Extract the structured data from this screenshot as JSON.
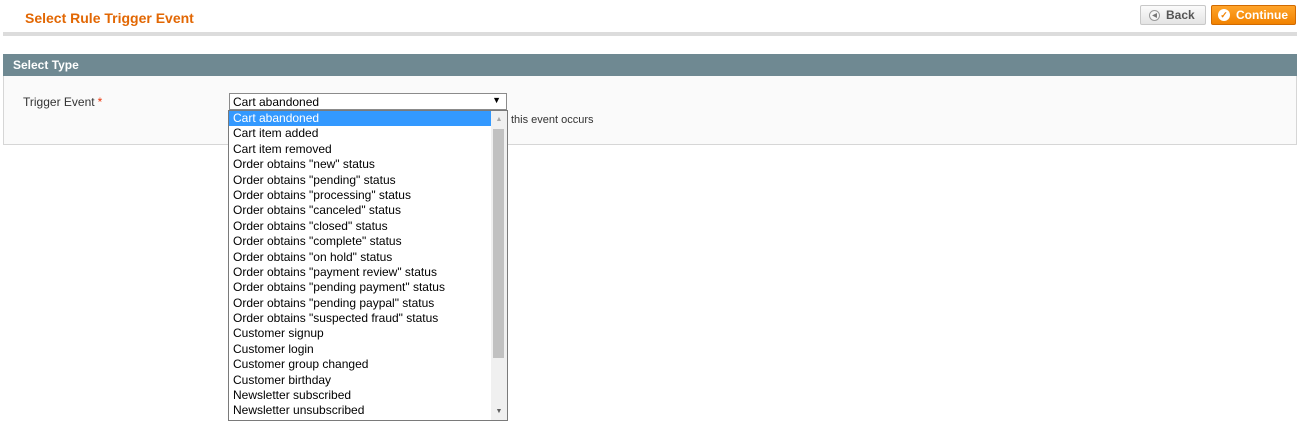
{
  "header": {
    "title": "Select Rule Trigger Event",
    "back_label": "Back",
    "continue_label": "Continue"
  },
  "fieldset": {
    "title": "Select Type",
    "trigger_label": "Trigger Event",
    "required_mark": "*",
    "selected_value": "Cart abandoned",
    "note_text": "this event occurs"
  },
  "dropdown": {
    "options": [
      "Cart abandoned",
      "Cart item added",
      "Cart item removed",
      "Order obtains \"new\" status",
      "Order obtains \"pending\" status",
      "Order obtains \"processing\" status",
      "Order obtains \"canceled\" status",
      "Order obtains \"closed\" status",
      "Order obtains \"complete\" status",
      "Order obtains \"on hold\" status",
      "Order obtains \"payment review\" status",
      "Order obtains \"pending payment\" status",
      "Order obtains \"pending paypal\" status",
      "Order obtains \"suspected fraud\" status",
      "Customer signup",
      "Customer login",
      "Customer group changed",
      "Customer birthday",
      "Newsletter subscribed",
      "Newsletter unsubscribed"
    ],
    "selected_index": 0
  },
  "icons": {
    "back": "back-arrow-icon",
    "continue": "checkmark-icon",
    "select_arrow": "chevron-down-icon"
  },
  "colors": {
    "title": "#e26703",
    "accent": "#f18200",
    "section_header": "#6f8992",
    "selection": "#3399ff",
    "required": "#eb340a"
  }
}
